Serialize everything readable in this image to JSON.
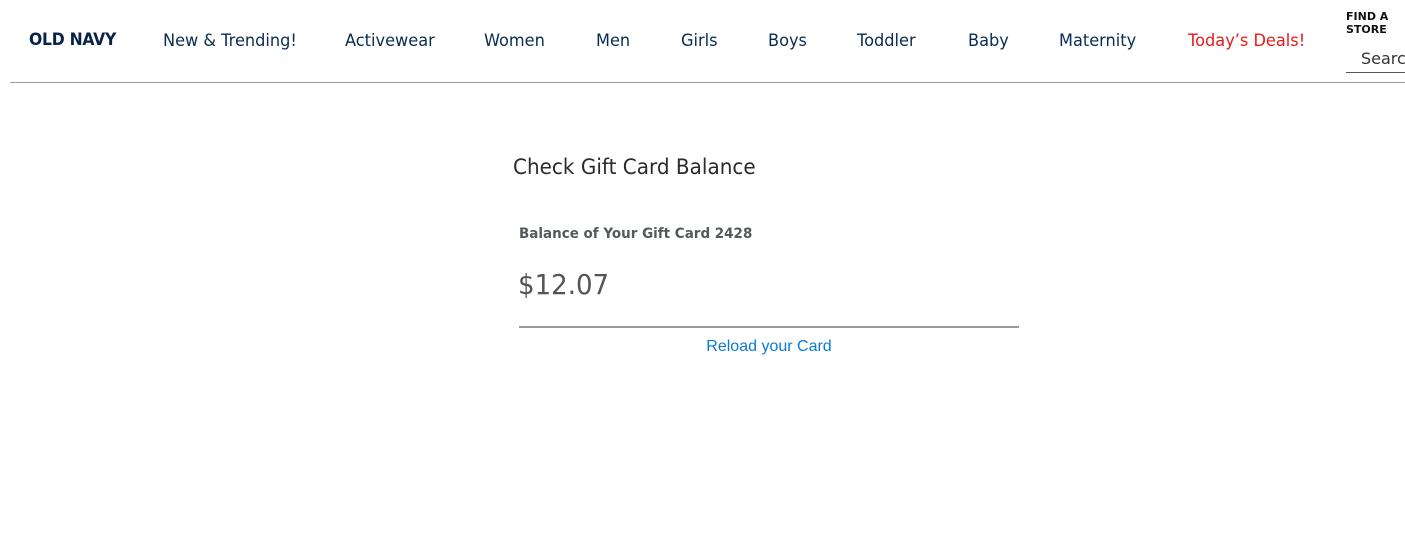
{
  "header": {
    "logo": "OLD NAVY",
    "nav_items": [
      {
        "label": "New & Trending!"
      },
      {
        "label": "Activewear"
      },
      {
        "label": "Women"
      },
      {
        "label": "Men"
      },
      {
        "label": "Girls"
      },
      {
        "label": "Boys"
      },
      {
        "label": "Toddler"
      },
      {
        "label": "Baby"
      },
      {
        "label": "Maternity"
      },
      {
        "label": "Today’s Deals!"
      }
    ],
    "find_store": "FIND A STORE",
    "search_placeholder": "Search"
  },
  "main": {
    "title": "Check Gift Card Balance",
    "balance_label": "Balance of Your Gift Card 2428",
    "balance_amount": "$12.07",
    "reload_link": "Reload your Card"
  },
  "colors": {
    "brand_navy": "#0a2248",
    "nav_text": "#0b2b53",
    "deals_red": "#e41a1a",
    "link_blue": "#0a7ad6",
    "rule_gray": "#9a9a9a"
  }
}
